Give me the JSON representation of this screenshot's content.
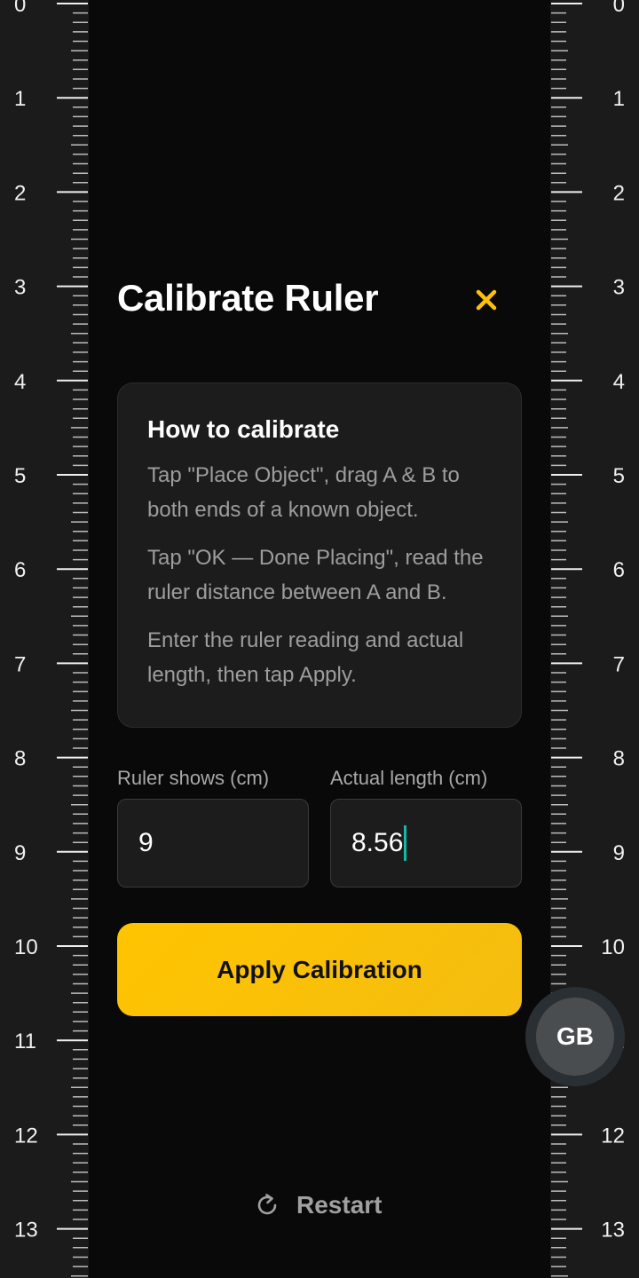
{
  "ruler": {
    "unit_labels": [
      "0",
      "1",
      "2",
      "3",
      "4",
      "5",
      "6",
      "7",
      "8",
      "9",
      "10",
      "11",
      "12",
      "13"
    ]
  },
  "dialog": {
    "title": "Calibrate Ruler",
    "close_icon": "close-x-icon",
    "accent_color": "#ffc107"
  },
  "instructions": {
    "heading": "How to calibrate",
    "steps": [
      "Tap \"Place Object\", drag A & B to both ends of a known object.",
      "Tap \"OK — Done Placing\", read the ruler distance between A and B.",
      "Enter the ruler reading and actual length, then tap Apply."
    ]
  },
  "form": {
    "ruler_label": "Ruler shows (cm)",
    "ruler_value": "9",
    "actual_label": "Actual length (cm)",
    "actual_value": "8.56"
  },
  "apply_button": {
    "label": "Apply Calibration"
  },
  "floating_button": {
    "label": "GB"
  },
  "restart": {
    "label": "Restart",
    "icon": "refresh-icon"
  }
}
